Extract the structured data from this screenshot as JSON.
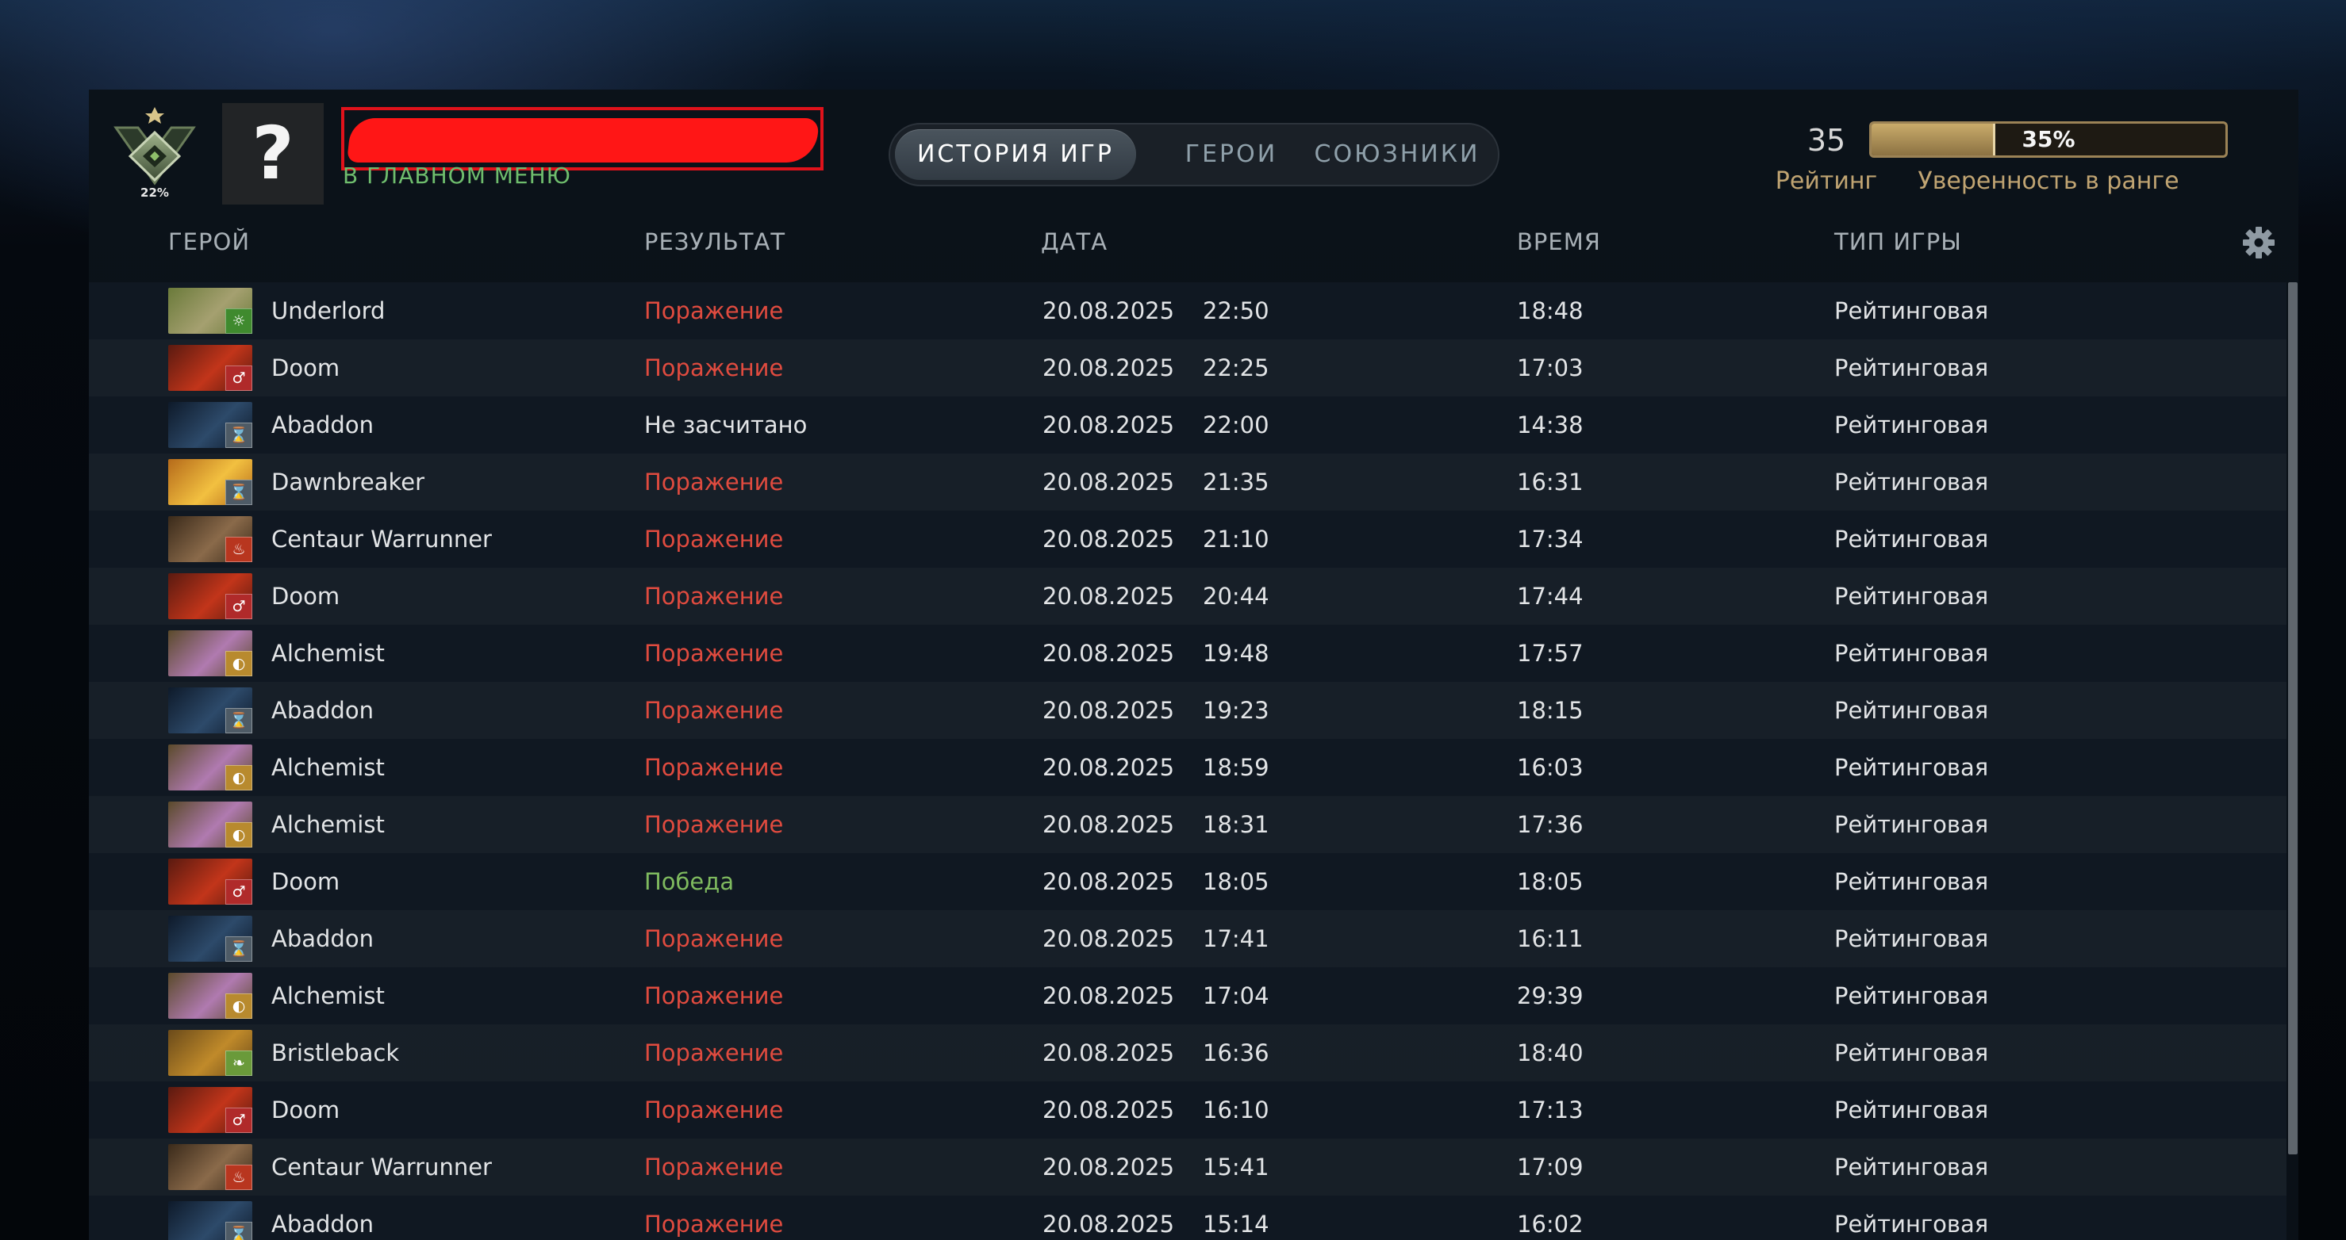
{
  "profile": {
    "rank_percent": "22%",
    "avatar_glyph": "?",
    "status": "В ГЛАВНОМ МЕНЮ"
  },
  "tabs": [
    {
      "label": "ИСТОРИЯ ИГР",
      "active": true
    },
    {
      "label": "ГЕРОИ",
      "active": false
    },
    {
      "label": "СОЮЗНИКИ",
      "active": false
    }
  ],
  "rating": {
    "value": "35",
    "label": "Рейтинг"
  },
  "confidence": {
    "text": "35%",
    "level": 0.35,
    "label": "Уверенность в ранге"
  },
  "columns": {
    "hero": "ГЕРОЙ",
    "result": "РЕЗУЛЬТАТ",
    "date": "ДАТА",
    "duration": "ВРЕМЯ",
    "game_type": "ТИП ИГРЫ"
  },
  "colors": {
    "loss": "#e04b3f",
    "win": "#7fba5f",
    "status": "#6fbd6d",
    "accent_gold": "#c0a472"
  },
  "attr_icons": {
    "universal": {
      "icon": "sun-icon",
      "glyph": "☼",
      "color": "#3f8a2e"
    },
    "strength": {
      "icon": "strength-icon",
      "glyph": "♂",
      "color": "#b02a2a"
    },
    "agility": {
      "icon": "agility-icon",
      "glyph": "❦",
      "color": "#3c8a3a"
    },
    "intelligence": {
      "icon": "intelligence-icon",
      "glyph": "☍",
      "color": "#2b68b0"
    },
    "hourglass": {
      "icon": "hourglass-icon",
      "glyph": "⌛",
      "color": "#4e5b66"
    },
    "flame": {
      "icon": "flame-icon",
      "glyph": "♨",
      "color": "#b8361f"
    },
    "coin": {
      "icon": "coin-icon",
      "glyph": "◐",
      "color": "#b88a2e"
    },
    "beast": {
      "icon": "paw-icon",
      "glyph": "❧",
      "color": "#6a9a3a"
    }
  },
  "matches": [
    {
      "hero": "Underlord",
      "result": "Поражение",
      "outcome": "loss",
      "date": "20.08.2025",
      "time": "22:50",
      "duration": "18:48",
      "game_type": "Рейтинговая",
      "portrait": [
        "#6a7a3a",
        "#a5a070"
      ],
      "attr": "universal"
    },
    {
      "hero": "Doom",
      "result": "Поражение",
      "outcome": "loss",
      "date": "20.08.2025",
      "time": "22:25",
      "duration": "17:03",
      "game_type": "Рейтинговая",
      "portrait": [
        "#5a1a10",
        "#c2351a"
      ],
      "attr": "strength"
    },
    {
      "hero": "Abaddon",
      "result": "Не засчитано",
      "outcome": "na",
      "date": "20.08.2025",
      "time": "22:00",
      "duration": "14:38",
      "game_type": "Рейтинговая",
      "portrait": [
        "#0e1a2a",
        "#2d4a6a"
      ],
      "attr": "hourglass"
    },
    {
      "hero": "Dawnbreaker",
      "result": "Поражение",
      "outcome": "loss",
      "date": "20.08.2025",
      "time": "21:35",
      "duration": "16:31",
      "game_type": "Рейтинговая",
      "portrait": [
        "#b56a1a",
        "#f2c040"
      ],
      "attr": "hourglass"
    },
    {
      "hero": "Centaur Warrunner",
      "result": "Поражение",
      "outcome": "loss",
      "date": "20.08.2025",
      "time": "21:10",
      "duration": "17:34",
      "game_type": "Рейтинговая",
      "portrait": [
        "#3a2a1a",
        "#8a6a4a"
      ],
      "attr": "flame"
    },
    {
      "hero": "Doom",
      "result": "Поражение",
      "outcome": "loss",
      "date": "20.08.2025",
      "time": "20:44",
      "duration": "17:44",
      "game_type": "Рейтинговая",
      "portrait": [
        "#5a1a10",
        "#c2351a"
      ],
      "attr": "strength"
    },
    {
      "hero": "Alchemist",
      "result": "Поражение",
      "outcome": "loss",
      "date": "20.08.2025",
      "time": "19:48",
      "duration": "17:57",
      "game_type": "Рейтинговая",
      "portrait": [
        "#5a4a2a",
        "#b07ab0"
      ],
      "attr": "coin"
    },
    {
      "hero": "Abaddon",
      "result": "Поражение",
      "outcome": "loss",
      "date": "20.08.2025",
      "time": "19:23",
      "duration": "18:15",
      "game_type": "Рейтинговая",
      "portrait": [
        "#0e1a2a",
        "#2d4a6a"
      ],
      "attr": "hourglass"
    },
    {
      "hero": "Alchemist",
      "result": "Поражение",
      "outcome": "loss",
      "date": "20.08.2025",
      "time": "18:59",
      "duration": "16:03",
      "game_type": "Рейтинговая",
      "portrait": [
        "#5a4a2a",
        "#b07ab0"
      ],
      "attr": "coin"
    },
    {
      "hero": "Alchemist",
      "result": "Поражение",
      "outcome": "loss",
      "date": "20.08.2025",
      "time": "18:31",
      "duration": "17:36",
      "game_type": "Рейтинговая",
      "portrait": [
        "#5a4a2a",
        "#b07ab0"
      ],
      "attr": "coin"
    },
    {
      "hero": "Doom",
      "result": "Победа",
      "outcome": "win",
      "date": "20.08.2025",
      "time": "18:05",
      "duration": "18:05",
      "game_type": "Рейтинговая",
      "portrait": [
        "#5a1a10",
        "#c2351a"
      ],
      "attr": "strength"
    },
    {
      "hero": "Abaddon",
      "result": "Поражение",
      "outcome": "loss",
      "date": "20.08.2025",
      "time": "17:41",
      "duration": "16:11",
      "game_type": "Рейтинговая",
      "portrait": [
        "#0e1a2a",
        "#2d4a6a"
      ],
      "attr": "hourglass"
    },
    {
      "hero": "Alchemist",
      "result": "Поражение",
      "outcome": "loss",
      "date": "20.08.2025",
      "time": "17:04",
      "duration": "29:39",
      "game_type": "Рейтинговая",
      "portrait": [
        "#5a4a2a",
        "#b07ab0"
      ],
      "attr": "coin"
    },
    {
      "hero": "Bristleback",
      "result": "Поражение",
      "outcome": "loss",
      "date": "20.08.2025",
      "time": "16:36",
      "duration": "18:40",
      "game_type": "Рейтинговая",
      "portrait": [
        "#6a4a1a",
        "#c08a2a"
      ],
      "attr": "beast"
    },
    {
      "hero": "Doom",
      "result": "Поражение",
      "outcome": "loss",
      "date": "20.08.2025",
      "time": "16:10",
      "duration": "17:13",
      "game_type": "Рейтинговая",
      "portrait": [
        "#5a1a10",
        "#c2351a"
      ],
      "attr": "strength"
    },
    {
      "hero": "Centaur Warrunner",
      "result": "Поражение",
      "outcome": "loss",
      "date": "20.08.2025",
      "time": "15:41",
      "duration": "17:09",
      "game_type": "Рейтинговая",
      "portrait": [
        "#3a2a1a",
        "#8a6a4a"
      ],
      "attr": "flame"
    },
    {
      "hero": "Abaddon",
      "result": "Поражение",
      "outcome": "loss",
      "date": "20.08.2025",
      "time": "15:14",
      "duration": "16:02",
      "game_type": "Рейтинговая",
      "portrait": [
        "#0e1a2a",
        "#2d4a6a"
      ],
      "attr": "hourglass"
    }
  ]
}
